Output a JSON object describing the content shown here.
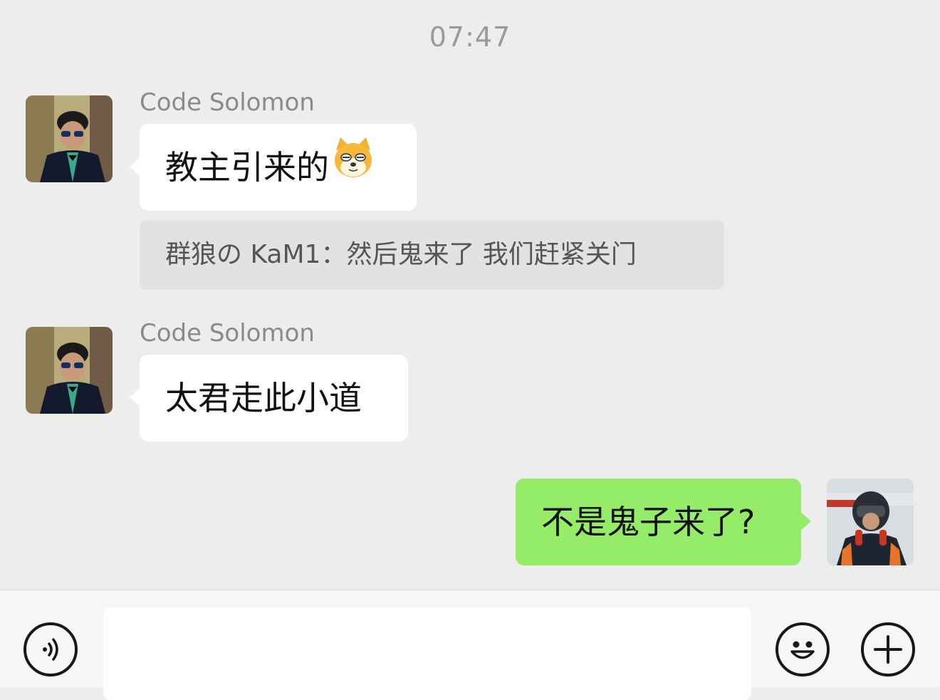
{
  "status": {
    "time": "07:47"
  },
  "messages": [
    {
      "sender": "Code Solomon",
      "text": "教主引来的",
      "emoji": "doge-cat-icon"
    },
    {
      "quote": "群狼の KaM1：然后鬼来了 我们赶紧关门"
    },
    {
      "sender": "Code Solomon",
      "text": "太君走此小道"
    },
    {
      "text": "不是鬼子来了?"
    }
  ],
  "input_bar": {
    "voice_icon": "voice-icon",
    "input_value": "",
    "emoji_icon": "emoji-icon",
    "plus_icon": "plus-icon"
  },
  "colors": {
    "background": "#ededed",
    "incoming_bubble": "#ffffff",
    "outgoing_bubble": "#95ec69",
    "quote_bubble": "#e2e2e2"
  }
}
